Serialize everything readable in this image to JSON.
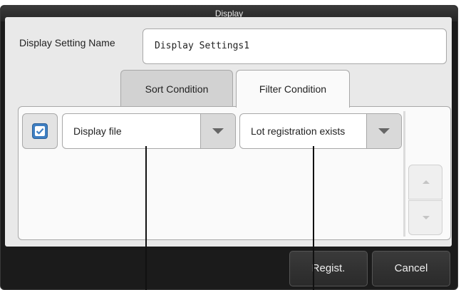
{
  "window": {
    "title": "Display"
  },
  "setting": {
    "label": "Display Setting Name",
    "value": "Display Settings1"
  },
  "tabs": [
    {
      "label": "Sort Condition",
      "active": false
    },
    {
      "label": "Filter Condition",
      "active": true
    }
  ],
  "filter": {
    "enabled": true,
    "field": {
      "value": "Display file",
      "icon": "triangle-down-icon"
    },
    "condition": {
      "value": "Lot registration exists",
      "icon": "triangle-down-icon"
    }
  },
  "scroll": {
    "up_icon": "arrow-up-icon",
    "down_icon": "arrow-down-icon"
  },
  "buttons": {
    "regist": "Regist.",
    "cancel": "Cancel"
  },
  "colors": {
    "checkbox": "#3f7fc2",
    "dialog_bg": "#1b1b1b",
    "panel_bg": "#e9e9e9"
  }
}
